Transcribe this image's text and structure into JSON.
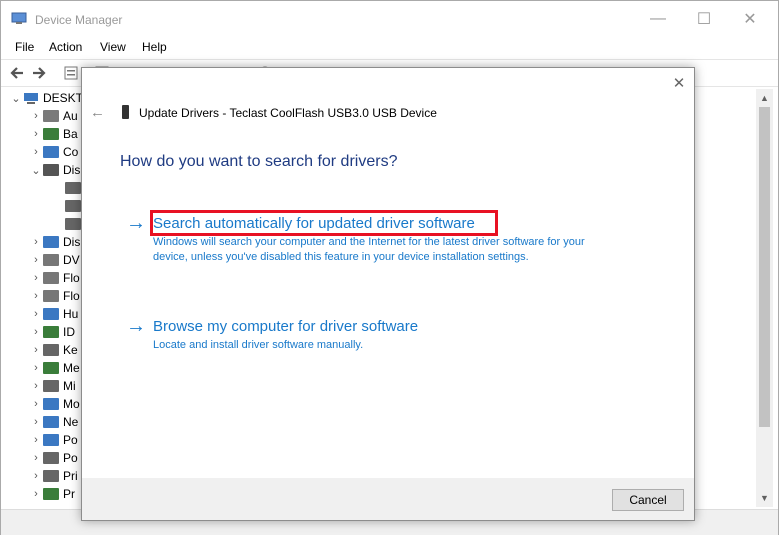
{
  "window": {
    "title": "Device Manager",
    "min_glyph": "—",
    "max_glyph": "☐",
    "close_glyph": "✕"
  },
  "menu": [
    "File",
    "Action",
    "View",
    "Help"
  ],
  "tree": {
    "root_label": "DESKT",
    "items": [
      {
        "label": "Au",
        "icon": "audio-icon",
        "color": "#7a7a7a",
        "chev": "›"
      },
      {
        "label": "Ba",
        "icon": "battery-icon",
        "color": "#3a7d3a",
        "chev": "›"
      },
      {
        "label": "Co",
        "icon": "computer-icon",
        "color": "#3b78c2",
        "chev": "›"
      },
      {
        "label": "Dis",
        "icon": "disk-drive-icon",
        "color": "#555555",
        "chev": "⌄"
      },
      {
        "label": "",
        "icon": "disk-icon",
        "color": "#666666",
        "chev": ""
      },
      {
        "label": "",
        "icon": "disk-icon",
        "color": "#666666",
        "chev": ""
      },
      {
        "label": "",
        "icon": "disk-icon",
        "color": "#666666",
        "chev": ""
      },
      {
        "label": "Dis",
        "icon": "display-adapter-icon",
        "color": "#3b78c2",
        "chev": "›"
      },
      {
        "label": "DV",
        "icon": "dvd-drive-icon",
        "color": "#777777",
        "chev": "›"
      },
      {
        "label": "Flo",
        "icon": "floppy-icon",
        "color": "#777777",
        "chev": "›"
      },
      {
        "label": "Flo",
        "icon": "floppy-drive-icon",
        "color": "#777777",
        "chev": "›"
      },
      {
        "label": "Hu",
        "icon": "hid-icon",
        "color": "#3b78c2",
        "chev": "›"
      },
      {
        "label": "ID",
        "icon": "ide-icon",
        "color": "#3a7d3a",
        "chev": "›"
      },
      {
        "label": "Ke",
        "icon": "keyboard-icon",
        "color": "#666666",
        "chev": "›"
      },
      {
        "label": "Me",
        "icon": "memory-icon",
        "color": "#3a7d3a",
        "chev": "›"
      },
      {
        "label": "Mi",
        "icon": "mouse-icon",
        "color": "#666666",
        "chev": "›"
      },
      {
        "label": "Mo",
        "icon": "monitor-icon",
        "color": "#3b78c2",
        "chev": "›"
      },
      {
        "label": "Ne",
        "icon": "network-icon",
        "color": "#3b78c2",
        "chev": "›"
      },
      {
        "label": "Po",
        "icon": "port-icon",
        "color": "#3b78c2",
        "chev": "›"
      },
      {
        "label": "Po",
        "icon": "power-icon",
        "color": "#666666",
        "chev": "›"
      },
      {
        "label": "Pri",
        "icon": "printer-icon",
        "color": "#666666",
        "chev": "›"
      },
      {
        "label": "Pr",
        "icon": "processor-icon",
        "color": "#3a7d3a",
        "chev": "›"
      }
    ]
  },
  "dialog": {
    "close_glyph": "✕",
    "back_glyph": "←",
    "title": "Update Drivers - Teclast CoolFlash USB3.0 USB Device",
    "question": "How do you want to search for drivers?",
    "option1": {
      "arrow": "→",
      "title": "Search automatically for updated driver software",
      "desc": "Windows will search your computer and the Internet for the latest driver software for your device, unless you've disabled this feature in your device installation settings."
    },
    "option2": {
      "arrow": "→",
      "title": "Browse my computer for driver software",
      "desc": "Locate and install driver software manually."
    },
    "cancel_label": "Cancel"
  },
  "colors": {
    "link": "#1979ca",
    "heading": "#1f3b82",
    "highlight": "#e81123"
  }
}
